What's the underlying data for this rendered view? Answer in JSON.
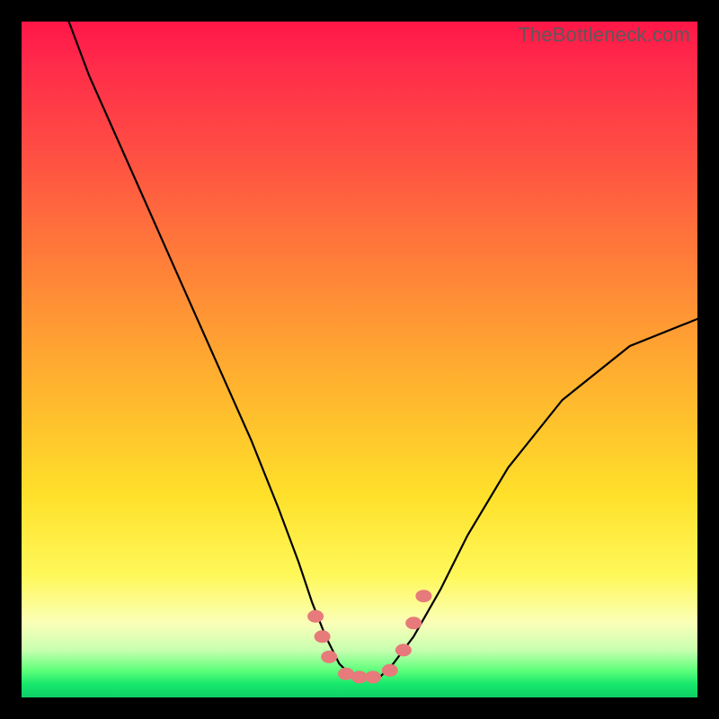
{
  "watermark": "TheBottleneck.com",
  "colors": {
    "frame": "#000000",
    "gradient_top": "#ff1648",
    "gradient_mid": "#ffe02a",
    "gradient_bottom": "#0fd067",
    "curve": "#000000",
    "marker": "#e77a7a"
  },
  "chart_data": {
    "type": "line",
    "title": "",
    "xlabel": "",
    "ylabel": "",
    "xlim": [
      0,
      100
    ],
    "ylim": [
      0,
      100
    ],
    "grid": false,
    "legend": false,
    "note": "Axes are unlabeled; values are normalized 0–100 estimated from pixel positions. y=100 is top (red/high bottleneck), y≈3 is the green floor (optimal).",
    "series": [
      {
        "name": "bottleneck-curve",
        "x": [
          7,
          10,
          14,
          18,
          22,
          26,
          30,
          34,
          38,
          41,
          43,
          45,
          47,
          49,
          51,
          53,
          55,
          58,
          62,
          66,
          72,
          80,
          90,
          100
        ],
        "y": [
          100,
          92,
          83,
          74,
          65,
          56,
          47,
          38,
          28,
          20,
          14,
          9,
          5,
          3,
          3,
          3,
          5,
          9,
          16,
          24,
          34,
          44,
          52,
          56
        ]
      }
    ],
    "markers": {
      "name": "highlight-dots",
      "points": [
        {
          "x": 43.5,
          "y": 12
        },
        {
          "x": 44.5,
          "y": 9
        },
        {
          "x": 45.5,
          "y": 6
        },
        {
          "x": 48.0,
          "y": 3.5
        },
        {
          "x": 50.0,
          "y": 3
        },
        {
          "x": 52.0,
          "y": 3
        },
        {
          "x": 54.5,
          "y": 4
        },
        {
          "x": 56.5,
          "y": 7
        },
        {
          "x": 58.0,
          "y": 11
        },
        {
          "x": 59.5,
          "y": 15
        }
      ]
    }
  }
}
